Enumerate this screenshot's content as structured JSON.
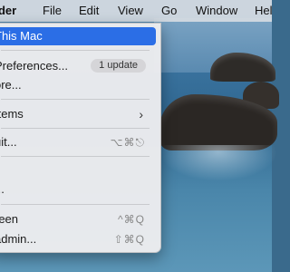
{
  "menubar": {
    "app_name": "nder",
    "items": [
      "File",
      "Edit",
      "View",
      "Go",
      "Window",
      "Hel"
    ]
  },
  "apple_menu": {
    "about": "This Mac",
    "preferences": "Preferences...",
    "update_badge": "1 update",
    "store": "ore...",
    "recent_items": "Items",
    "force_quit": "uit...",
    "force_quit_shortcut": "⌥⌘⎋",
    "restart": "...",
    "lock_screen": "reen",
    "lock_screen_shortcut": "^⌘Q",
    "logout": "admin...",
    "logout_shortcut": "⇧⌘Q"
  },
  "colors": {
    "selection": "#2b6ee6",
    "menubar": "#d6dbe2"
  }
}
